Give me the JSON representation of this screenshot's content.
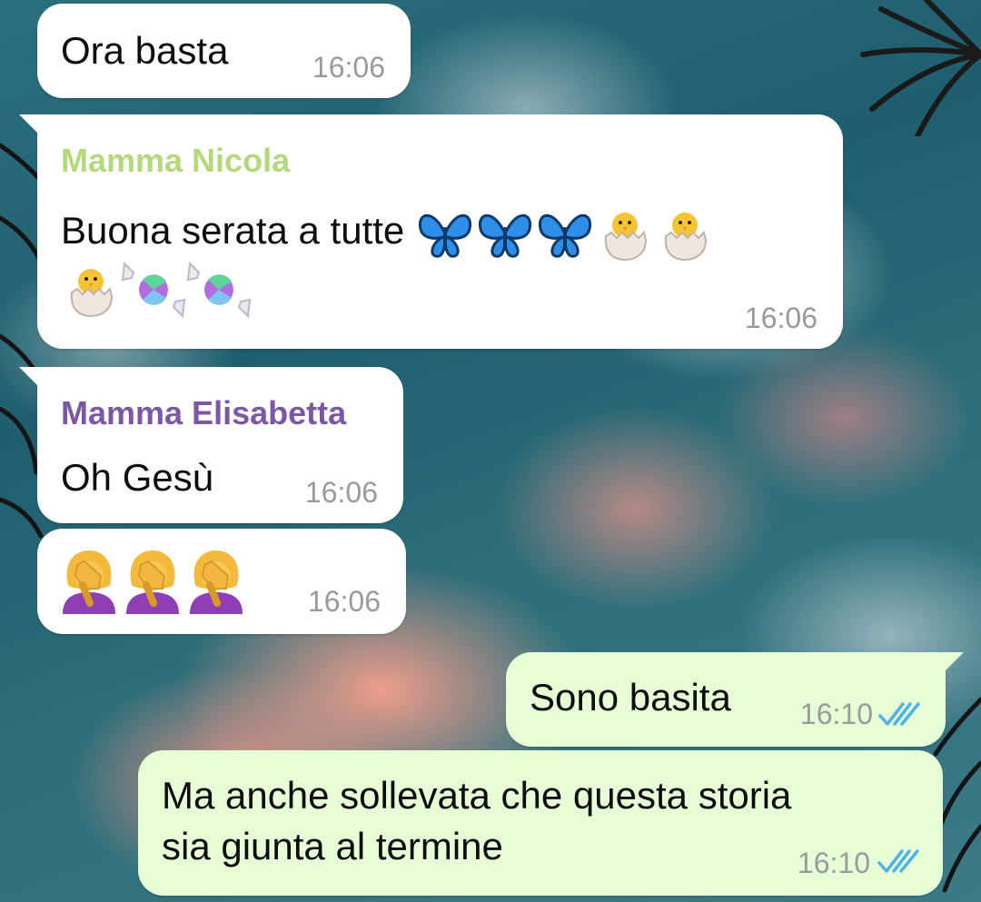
{
  "chat": {
    "messages": [
      {
        "direction": "incoming",
        "text": "Ora basta",
        "time": "16:06"
      },
      {
        "direction": "incoming",
        "sender": "Mamma Nicola",
        "sender_color": "#b4d97a",
        "text": "Buona serata a tutte",
        "emoji": [
          "butterfly",
          "butterfly",
          "butterfly",
          "hatching-chick",
          "hatching-chick",
          "hatching-chick",
          "candy",
          "candy"
        ],
        "time": "16:06"
      },
      {
        "direction": "incoming",
        "sender": "Mamma Elisabetta",
        "sender_color": "#7b57a5",
        "text": "Oh Gesù",
        "time": "16:06"
      },
      {
        "direction": "incoming",
        "emoji": [
          "face-palm-woman",
          "face-palm-woman",
          "face-palm-woman"
        ],
        "time": "16:06"
      },
      {
        "direction": "outgoing",
        "text": "Sono basita",
        "time": "16:10",
        "status": "read"
      },
      {
        "direction": "outgoing",
        "text_lines": [
          "Ma anche sollevata che questa storia",
          "sia giunta al termine"
        ],
        "time": "16:10",
        "status": "read"
      }
    ]
  },
  "colors": {
    "incoming_bubble": "#ffffff",
    "outgoing_bubble": "#e7fdd6",
    "read_ticks": "#4fb3e8",
    "timestamp": "#9a9a9a"
  }
}
